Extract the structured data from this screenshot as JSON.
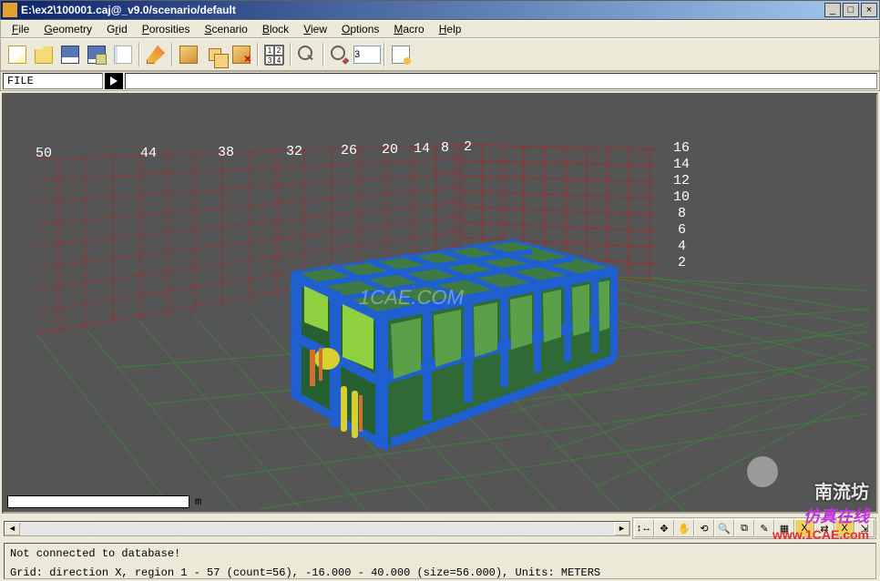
{
  "window": {
    "title": "E:\\ex2\\100001.caj@_v9.0/scenario/default",
    "min": "_",
    "max": "□",
    "close": "×"
  },
  "menu": {
    "file": "File",
    "geometry": "Geometry",
    "grid": "Grid",
    "porosities": "Porosities",
    "scenario": "Scenario",
    "block": "Block",
    "view": "View",
    "options": "Options",
    "macro": "Macro",
    "help": "Help"
  },
  "toolbar": {
    "quad": {
      "c1": "1",
      "c2": "2",
      "c3": "3",
      "c4": "4"
    },
    "spin_value": "3"
  },
  "filebar": {
    "label": "FILE",
    "value": ""
  },
  "axes": {
    "x": [
      "50",
      "44",
      "38",
      "32",
      "26",
      "20",
      "14",
      "8",
      "2"
    ],
    "z": [
      "16",
      "14",
      "12",
      "10",
      "8",
      "6",
      "4",
      "2"
    ]
  },
  "ruler": {
    "unit": "m"
  },
  "status": {
    "line1": "Not connected to database!",
    "line2": "Grid: direction X, region 1 - 57 (count=56), -16.000 - 40.000 (size=56.000), Units: METERS"
  },
  "watermark": {
    "center": "1CAE.COM",
    "wm1": "南流坊",
    "wm2": "仿真在线",
    "wm3": "www.1CAE.com"
  },
  "icons": {
    "new": "new-file-icon",
    "open": "open-folder-icon",
    "save": "save-icon",
    "saveall": "save-all-icon",
    "page": "page-icon",
    "edit": "edit-icon",
    "box": "box-icon",
    "boxes": "boxes-icon",
    "boxdel": "box-delete-icon",
    "quad": "view-quad-icon",
    "zoom": "zoom-icon",
    "zoomarea": "zoom-area-icon",
    "spin": "spin-value",
    "props": "properties-icon"
  }
}
